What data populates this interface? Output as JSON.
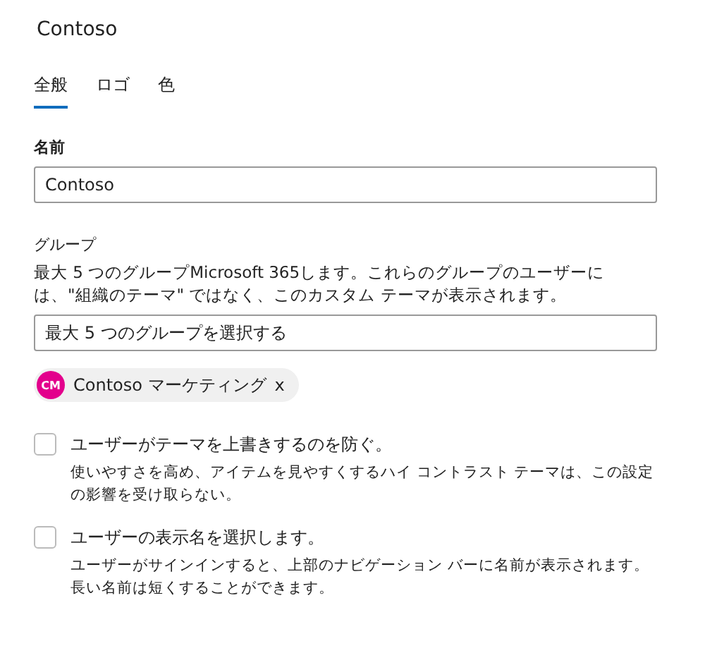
{
  "title": "Contoso",
  "tabs": [
    {
      "label": "全般",
      "selected": true
    },
    {
      "label": "ロゴ",
      "selected": false
    },
    {
      "label": "色",
      "selected": false
    }
  ],
  "name_field": {
    "label": "名前",
    "value": "Contoso"
  },
  "groups": {
    "label": "グループ",
    "description": "最大 5 つのグループMicrosoft 365します。これらのグループのユーザーには、\"組織のテーマ\" ではなく、このカスタム テーマが表示されます。",
    "placeholder": "最大 5 つのグループを選択する",
    "chips": [
      {
        "initials": "CM",
        "color": "#e3008c",
        "label": "Contoso マーケティング",
        "remove": "x"
      }
    ]
  },
  "options": [
    {
      "label": "ユーザーがテーマを上書きするのを防ぐ。",
      "checked": false,
      "description": "使いやすさを高め、アイテムを見やすくするハイ コントラスト テーマは、この設定の影響を受け取らない。"
    },
    {
      "label": "ユーザーの表示名を選択します。",
      "checked": false,
      "description": "ユーザーがサインインすると、上部のナビゲーション バーに名前が表示されます。長い名前は短くすることができます。"
    }
  ]
}
